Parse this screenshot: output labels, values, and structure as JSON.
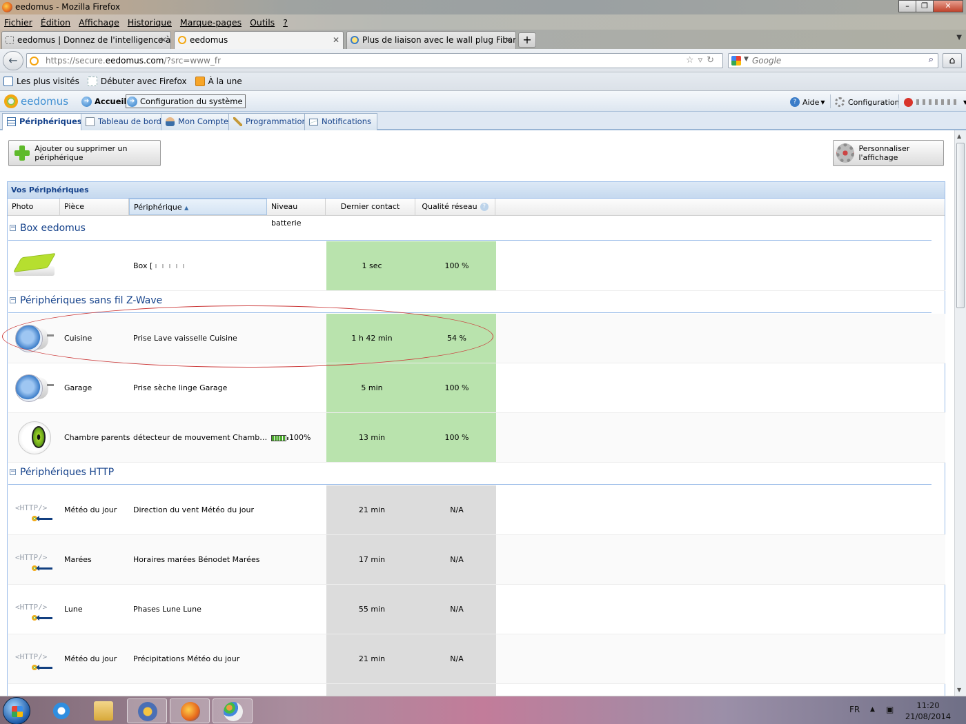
{
  "window": {
    "title": "eedomus - Mozilla Firefox"
  },
  "menu": [
    "Fichier",
    "Édition",
    "Affichage",
    "Historique",
    "Marque-pages",
    "Outils",
    "?"
  ],
  "tabs": [
    {
      "label": "eedomus | Donnez de l'intelligence à ...",
      "active": false
    },
    {
      "label": "eedomus",
      "active": true
    },
    {
      "label": "Plus de liaison avec le wall plug Fibar...",
      "active": false
    }
  ],
  "navbar": {
    "url_prefix": "https://secure.",
    "url_domain": "eedomus.com",
    "url_path": "/?src=www_fr",
    "search_placeholder": "Google"
  },
  "bookmarks": [
    "Les plus visités",
    "Débuter avec Firefox",
    "À la une"
  ],
  "app": {
    "logo": "eedomus",
    "nav_accueil": "Accueil",
    "nav_config": "Configuration du système",
    "aide": "Aide",
    "configuration": "Configuration",
    "tabs": [
      "Périphériques",
      "Tableau de bord",
      "Mon Compte",
      "Programmation",
      "Notifications"
    ]
  },
  "toolbar": {
    "add_label": "Ajouter ou supprimer un périphérique",
    "customize_label": "Personnaliser l'affichage"
  },
  "grid": {
    "title": "Vos Périphériques",
    "columns": [
      "Photo",
      "Pièce",
      "Périphérique",
      "Niveau batterie",
      "Dernier contact",
      "Qualité réseau"
    ],
    "sorted_column": "Périphérique"
  },
  "groups": [
    {
      "name": "Box eedomus",
      "rows": [
        {
          "image": "box",
          "piece": "",
          "peripherique": "Box [",
          "batterie": "",
          "contact": "1 sec",
          "reseau": "100 %",
          "status": "ok"
        }
      ]
    },
    {
      "name": "Périphériques sans fil Z-Wave",
      "rows": [
        {
          "image": "plug",
          "piece": "Cuisine",
          "peripherique": "Prise Lave vaisselle Cuisine",
          "batterie": "",
          "contact": "1 h 42 min",
          "reseau": "54 %",
          "status": "ok"
        },
        {
          "image": "plug",
          "piece": "Garage",
          "peripherique": "Prise sèche linge Garage",
          "batterie": "",
          "contact": "5 min",
          "reseau": "100 %",
          "status": "ok"
        },
        {
          "image": "eye",
          "piece": "Chambre parents",
          "peripherique": "détecteur de mouvement Chambre p...",
          "batterie": "100%",
          "contact": "13 min",
          "reseau": "100 %",
          "status": "ok"
        }
      ]
    },
    {
      "name": "Périphériques HTTP",
      "rows": [
        {
          "image": "http",
          "piece": "Météo du jour",
          "peripherique": "Direction du vent Météo du jour",
          "batterie": "",
          "contact": "21 min",
          "reseau": "N/A",
          "status": "na"
        },
        {
          "image": "http",
          "piece": "Marées",
          "peripherique": "Horaires marées Bénodet Marées",
          "batterie": "",
          "contact": "17 min",
          "reseau": "N/A",
          "status": "na"
        },
        {
          "image": "http",
          "piece": "Lune",
          "peripherique": "Phases Lune Lune",
          "batterie": "",
          "contact": "55 min",
          "reseau": "N/A",
          "status": "na"
        },
        {
          "image": "http",
          "piece": "Météo du jour",
          "peripherique": "Précipitations Météo du jour",
          "batterie": "",
          "contact": "21 min",
          "reseau": "N/A",
          "status": "na"
        }
      ]
    }
  ],
  "taskbar": {
    "lang": "FR",
    "time": "11:20",
    "date": "21/08/2014"
  },
  "colors": {
    "ok": "#b9e3ad",
    "na": "#dcdcdc",
    "accent": "#15428b"
  }
}
